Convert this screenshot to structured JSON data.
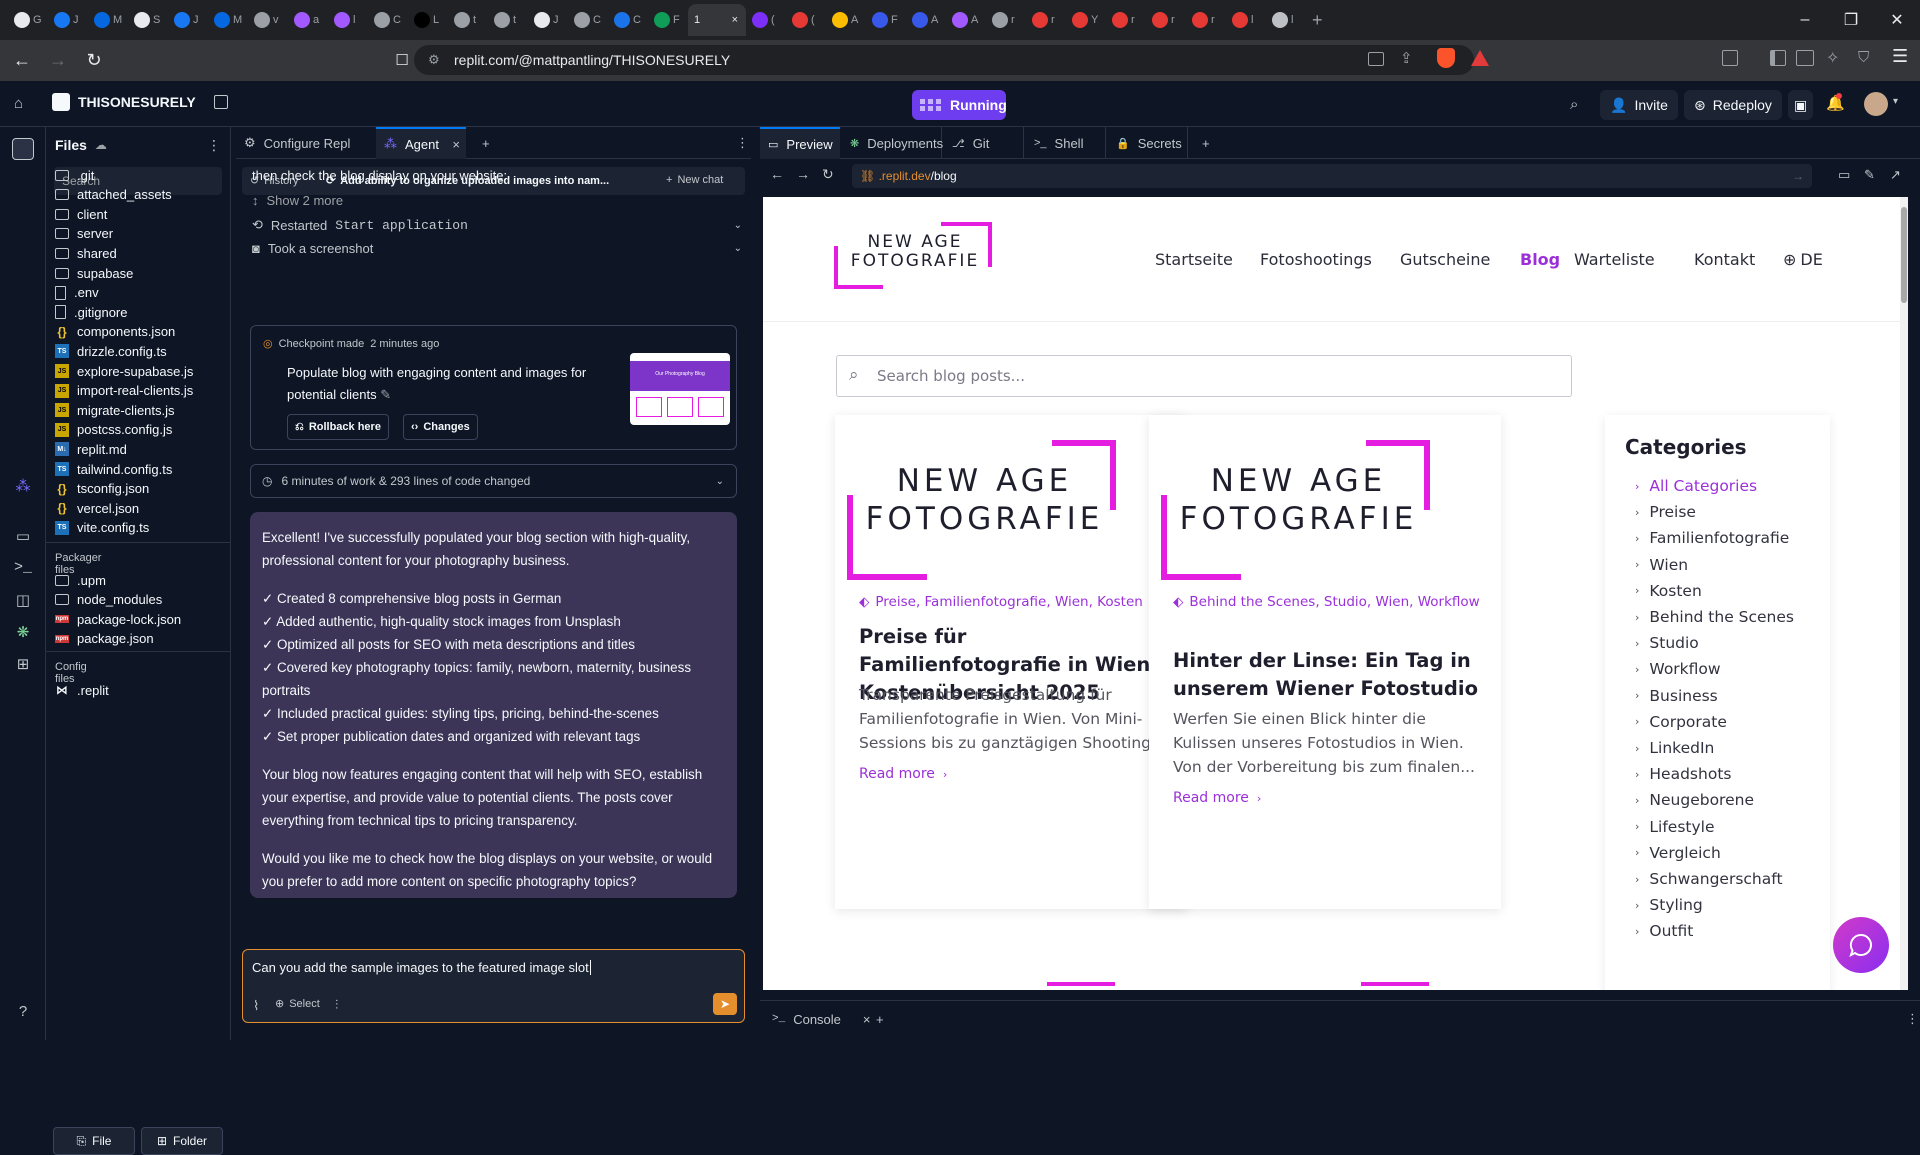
{
  "browser": {
    "tabs": [
      {
        "icon": "github",
        "label": "G"
      },
      {
        "icon": "facebook",
        "label": "J"
      },
      {
        "icon": "meta",
        "label": "M"
      },
      {
        "icon": "github",
        "label": "S"
      },
      {
        "icon": "facebook",
        "label": "J"
      },
      {
        "icon": "meta",
        "label": "M"
      },
      {
        "icon": "globe",
        "label": "v"
      },
      {
        "icon": "purple",
        "label": "a"
      },
      {
        "icon": "purple",
        "label": "l"
      },
      {
        "icon": "globe",
        "label": "C"
      },
      {
        "icon": "x",
        "label": "L"
      },
      {
        "icon": "globe",
        "label": "t"
      },
      {
        "icon": "globe",
        "label": "t"
      },
      {
        "icon": "github",
        "label": "J"
      },
      {
        "icon": "globe",
        "label": "C"
      },
      {
        "icon": "blue",
        "label": "C"
      },
      {
        "icon": "green",
        "label": "F"
      },
      {
        "icon": "active",
        "label": "1"
      },
      {
        "icon": "mail",
        "label": "("
      },
      {
        "icon": "red",
        "label": "("
      },
      {
        "icon": "drive",
        "label": "A"
      },
      {
        "icon": "wp",
        "label": "F"
      },
      {
        "icon": "wp",
        "label": "A"
      },
      {
        "icon": "purple",
        "label": "A"
      },
      {
        "icon": "globe",
        "label": "r"
      },
      {
        "icon": "red",
        "label": "r"
      },
      {
        "icon": "red",
        "label": "Y"
      },
      {
        "icon": "red",
        "label": "r"
      },
      {
        "icon": "red",
        "label": "r"
      },
      {
        "icon": "red",
        "label": "r"
      },
      {
        "icon": "red",
        "label": "l"
      },
      {
        "icon": "generic",
        "label": "l"
      }
    ],
    "active_tab_close": "×",
    "url": "replit.com/@mattpantling/THISONESURELY"
  },
  "replit": {
    "repl_name": "THISONESURELY",
    "run_label": "Running",
    "invite_label": "Invite",
    "redeploy_label": "Redeploy"
  },
  "files": {
    "title": "Files",
    "search_placeholder": "Search",
    "items": [
      {
        "name": ".git",
        "type": "folder"
      },
      {
        "name": "attached_assets",
        "type": "folder"
      },
      {
        "name": "client",
        "type": "folder"
      },
      {
        "name": "server",
        "type": "folder"
      },
      {
        "name": "shared",
        "type": "folder"
      },
      {
        "name": "supabase",
        "type": "folder"
      },
      {
        "name": ".env",
        "type": "file"
      },
      {
        "name": ".gitignore",
        "type": "file"
      },
      {
        "name": "components.json",
        "type": "json"
      },
      {
        "name": "drizzle.config.ts",
        "type": "ts"
      },
      {
        "name": "explore-supabase.js",
        "type": "js"
      },
      {
        "name": "import-real-clients.js",
        "type": "js"
      },
      {
        "name": "migrate-clients.js",
        "type": "js"
      },
      {
        "name": "postcss.config.js",
        "type": "js"
      },
      {
        "name": "replit.md",
        "type": "md"
      },
      {
        "name": "tailwind.config.ts",
        "type": "ts"
      },
      {
        "name": "tsconfig.json",
        "type": "json"
      },
      {
        "name": "vercel.json",
        "type": "json"
      },
      {
        "name": "vite.config.ts",
        "type": "ts"
      }
    ],
    "packager_title": "Packager files",
    "packager_items": [
      {
        "name": ".upm",
        "type": "folder"
      },
      {
        "name": "node_modules",
        "type": "folder"
      },
      {
        "name": "package-lock.json",
        "type": "npm"
      },
      {
        "name": "package.json",
        "type": "npm"
      }
    ],
    "config_title": "Config files",
    "config_items": [
      {
        "name": ".replit",
        "type": "replit"
      }
    ],
    "new_file_label": "File",
    "new_folder_label": "Folder"
  },
  "agent": {
    "tabs": {
      "configure": "Configure Repl",
      "agent": "Agent"
    },
    "history_label": "History",
    "chat_title": "Add ability to organize uploaded images into nam...",
    "new_chat_label": "New chat",
    "prev_text": "then check the blog display on your website:",
    "show_more": "Show 2 more",
    "restarted_label": "Restarted",
    "restarted_target": "Start application",
    "screenshot_label": "Took a screenshot",
    "checkpoint": {
      "label": "Checkpoint made",
      "time": "2 minutes ago",
      "description": "Populate blog with engaging content and images for potential clients",
      "rollback_label": "Rollback here",
      "changes_label": "Changes",
      "thumb_title": "Our Photography Blog"
    },
    "worklog": "6 minutes of work & 293 lines of code changed",
    "message": {
      "intro": "Excellent! I've successfully populated your blog section with high-quality, professional content for your photography business.",
      "bullets": [
        "✓ Created 8 comprehensive blog posts in German",
        "✓ Added authentic, high-quality stock images from Unsplash",
        "✓ Optimized all posts for SEO with meta descriptions and titles",
        "✓ Covered key photography topics: family, newborn, maternity, business portraits",
        "✓ Included practical guides: styling tips, pricing, behind-the-scenes",
        "✓ Set proper publication dates and organized with relevant tags"
      ],
      "para2": "Your blog now features engaging content that will help with SEO, establish your expertise, and provide value to potential clients. The posts cover everything from technical tips to pricing transparency.",
      "para3": "Would you like me to check how the blog displays on your website, or would you prefer to add more content on specific photography topics?"
    },
    "input_text": "Can you add the sample images to the featured image slot",
    "select_label": "Select"
  },
  "preview": {
    "tabs": [
      "Preview",
      "Deployments",
      "Git",
      "Shell",
      "Secrets"
    ],
    "url_domain": ".replit.dev",
    "url_path": "/blog",
    "console_label": "Console"
  },
  "site": {
    "logo_line1": "NEW AGE",
    "logo_line2": "FOTOGRAFIE",
    "nav": [
      "Startseite",
      "Fotoshootings",
      "Gutscheine",
      "Blog",
      "Warteliste",
      "Kontakt"
    ],
    "nav_active": "Blog",
    "lang": "DE",
    "search_placeholder": "Search blog posts...",
    "posts": [
      {
        "tags": "Preise,  Familienfotografie,  Wien,  Kosten",
        "title": "Preise für Familienfotografie in Wien – Kostenübersicht 2025",
        "excerpt": "Transparente Preisgestaltung für Familienfotografie in Wien. Von Mini-Sessions bis zu ganztägigen Shooting...",
        "read_more": "Read more"
      },
      {
        "tags": "Behind the Scenes,  Studio,  Wien,  Workflow",
        "title": "Hinter der Linse: Ein Tag in unserem Wiener Fotostudio",
        "excerpt": "Werfen Sie einen Blick hinter die Kulissen unseres Fotostudios in Wien. Von der Vorbereitung bis zum finalen...",
        "read_more": "Read more"
      }
    ],
    "categories_title": "Categories",
    "categories": [
      "All Categories",
      "Preise",
      "Familienfotografie",
      "Wien",
      "Kosten",
      "Behind the Scenes",
      "Studio",
      "Workflow",
      "Business",
      "Corporate",
      "LinkedIn",
      "Headshots",
      "Neugeborene",
      "Lifestyle",
      "Vergleich",
      "Schwangerschaft",
      "Styling",
      "Outfit"
    ],
    "accent_color": "#9b30d9",
    "logo_color": "#e51de0"
  }
}
